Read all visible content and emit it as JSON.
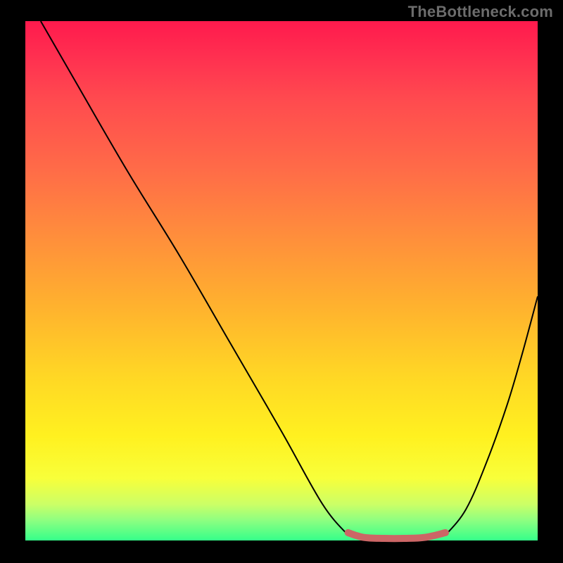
{
  "watermark": "TheBottleneck.com",
  "chart_data": {
    "type": "line",
    "title": "",
    "xlabel": "",
    "ylabel": "",
    "xlim": [
      0,
      100
    ],
    "ylim": [
      0,
      100
    ],
    "series": [
      {
        "name": "curve-left",
        "x": [
          3,
          10,
          20,
          30,
          40,
          50,
          58,
          63
        ],
        "y": [
          100,
          88,
          71,
          55,
          38,
          21,
          7,
          1
        ]
      },
      {
        "name": "curve-right",
        "x": [
          82,
          86,
          90,
          94,
          97,
          100
        ],
        "y": [
          1,
          6,
          15,
          26,
          36,
          47
        ]
      },
      {
        "name": "highlight-band",
        "x": [
          63,
          66,
          70,
          74,
          78,
          82
        ],
        "y": [
          1.5,
          0.6,
          0.4,
          0.4,
          0.6,
          1.5
        ]
      }
    ],
    "colors": {
      "curve": "#000000",
      "highlight": "#cc6666",
      "gradient_top": "#ff1a4d",
      "gradient_bottom": "#35ff8a"
    }
  }
}
